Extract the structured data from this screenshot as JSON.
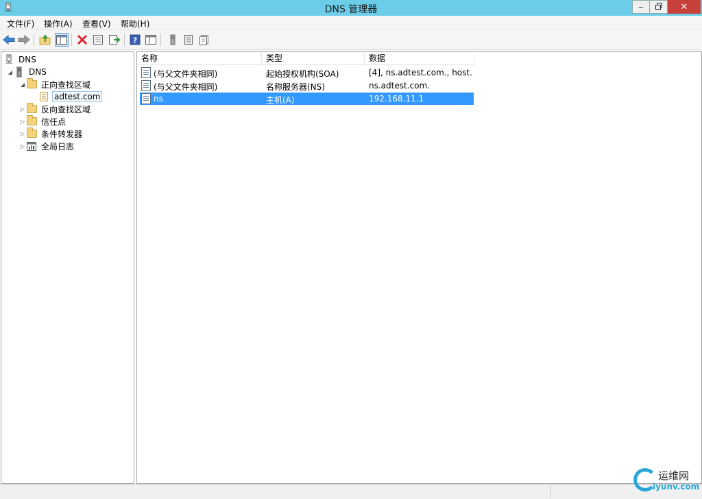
{
  "window": {
    "title": "DNS 管理器",
    "minimize_icon": "minimize-icon",
    "restore_icon": "restore-icon",
    "close_icon": "close-icon"
  },
  "menubar": {
    "items": [
      {
        "label": "文件(F)"
      },
      {
        "label": "操作(A)"
      },
      {
        "label": "查看(V)"
      },
      {
        "label": "帮助(H)"
      }
    ]
  },
  "toolbar": {
    "icons": [
      "back-arrow-icon",
      "forward-arrow-icon",
      "up-folder-icon",
      "show-hide-tree-icon",
      "delete-icon",
      "properties-icon",
      "export-list-icon",
      "help-icon",
      "console-icon",
      "server-icon",
      "zone-icon",
      "record-icon"
    ]
  },
  "tree": {
    "root": "DNS",
    "server": "DNS",
    "items": [
      {
        "label": "正向查找区域"
      },
      {
        "label": "adtest.com"
      },
      {
        "label": "反向查找区域"
      },
      {
        "label": "信任点"
      },
      {
        "label": "条件转发器"
      },
      {
        "label": "全局日志"
      }
    ]
  },
  "list": {
    "columns": [
      "名称",
      "类型",
      "数据"
    ],
    "rows": [
      {
        "name": "(与父文件夹相同)",
        "type": "起始授权机构(SOA)",
        "data": "[4], ns.adtest.com., host..."
      },
      {
        "name": "(与父文件夹相同)",
        "type": "名称服务器(NS)",
        "data": "ns.adtest.com."
      },
      {
        "name": "ns",
        "type": "主机(A)",
        "data": "192.168.11.1"
      }
    ]
  },
  "watermark": {
    "cn": "运维网",
    "en": "iyunv.com"
  },
  "colors": {
    "titlebar": "#6ccde8",
    "selection": "#3399ff",
    "close_button": "#c7403a"
  }
}
